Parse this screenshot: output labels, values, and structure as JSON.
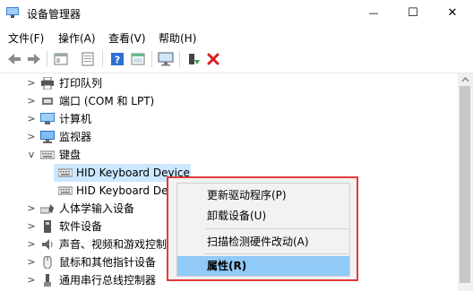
{
  "window": {
    "title": "设备管理器",
    "minimize_symbol": "—",
    "maximize_symbol": "☐",
    "close_symbol": "✕"
  },
  "menu": {
    "file": "文件(F)",
    "action": "操作(A)",
    "view": "查看(V)",
    "help": "帮助(H)"
  },
  "toolbar": {
    "icons": [
      "back-icon",
      "forward-icon",
      "properties-icon",
      "update-driver-icon",
      "help-icon",
      "show-hidden-icon",
      "monitor-icon",
      "enable-device-icon",
      "uninstall-icon"
    ],
    "uninstall_color": "#d81e1e"
  },
  "tree": {
    "items": [
      {
        "label": "打印队列",
        "icon": "printer-icon",
        "expander": ">"
      },
      {
        "label": "端口 (COM 和 LPT)",
        "icon": "port-icon",
        "expander": ">"
      },
      {
        "label": "计算机",
        "icon": "computer-icon",
        "expander": ">"
      },
      {
        "label": "监视器",
        "icon": "monitor-icon",
        "expander": ">"
      },
      {
        "label": "键盘",
        "icon": "keyboard-icon",
        "expander": "v"
      },
      {
        "label": "HID Keyboard Device",
        "icon": "keyboard-icon",
        "expander": ""
      },
      {
        "label": "HID Keyboard Dev",
        "icon": "keyboard-icon",
        "expander": ""
      },
      {
        "label": "人体学输入设备",
        "icon": "hid-icon",
        "expander": ">"
      },
      {
        "label": "软件设备",
        "icon": "software-device-icon",
        "expander": ">"
      },
      {
        "label": "声音、视频和游戏控制器",
        "icon": "speaker-icon",
        "expander": ">"
      },
      {
        "label": "鼠标和其他指针设备",
        "icon": "mouse-icon",
        "expander": ">"
      },
      {
        "label": "通用串行总线控制器",
        "icon": "usb-icon",
        "expander": ">"
      }
    ]
  },
  "context_menu": {
    "update_driver": "更新驱动程序(P)",
    "uninstall": "卸载设备(U)",
    "scan": "扫描检测硬件改动(A)",
    "properties": "属性(R)",
    "highlight_color": "#e23a3a",
    "selected_color": "#91c9f7"
  }
}
